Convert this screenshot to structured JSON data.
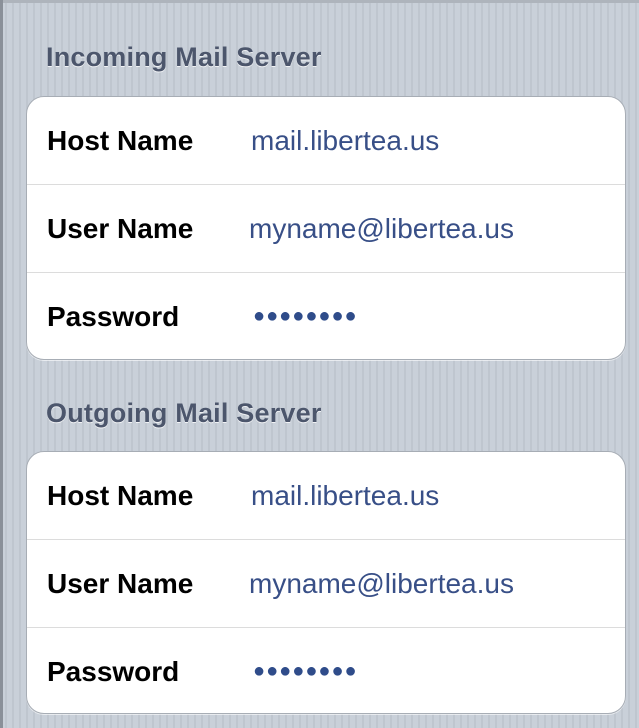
{
  "incoming": {
    "header": "Incoming Mail Server",
    "host_name_label": "Host Name",
    "host_name_value": "mail.libertea.us",
    "user_name_label": "User Name",
    "user_name_value": "myname@libertea.us",
    "password_label": "Password",
    "password_value": "●●●●●●●●"
  },
  "outgoing": {
    "header": "Outgoing Mail Server",
    "host_name_label": "Host Name",
    "host_name_value": "mail.libertea.us",
    "user_name_label": "User Name",
    "user_name_value": "myname@libertea.us",
    "password_label": "Password",
    "password_value": "●●●●●●●●"
  },
  "colors": {
    "section_header": "#4c566c",
    "value_text": "#384f87",
    "label_text": "#000000",
    "background": "#c5ccd5"
  }
}
